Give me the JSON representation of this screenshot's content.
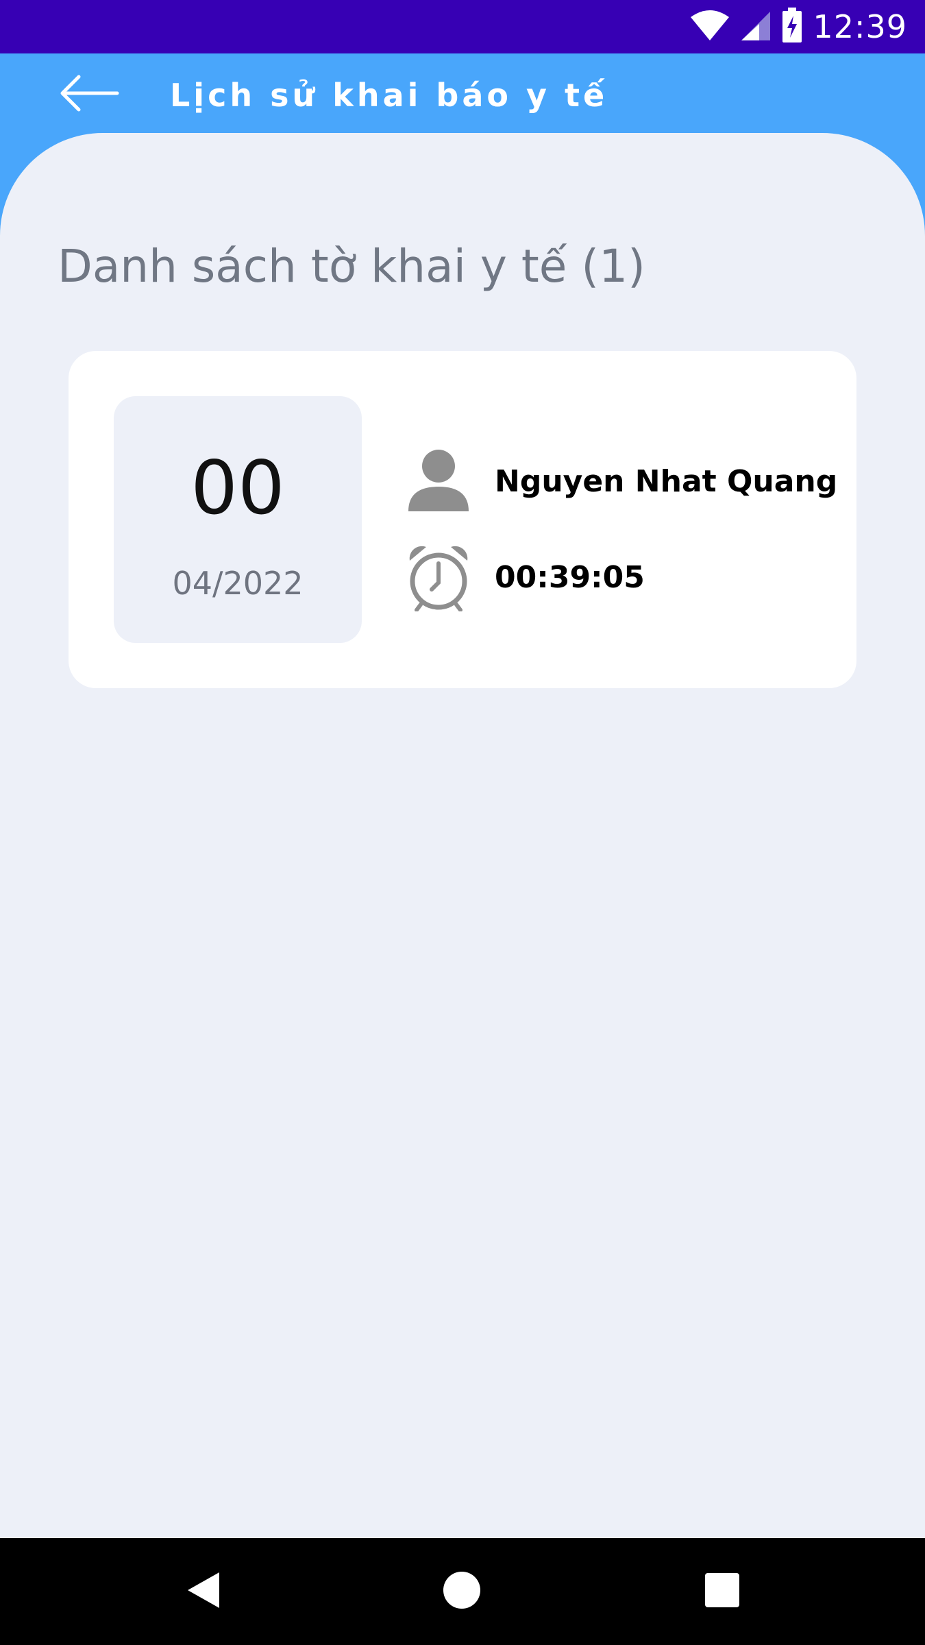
{
  "status_bar": {
    "time": "12:39",
    "icons": [
      "wifi-icon",
      "signal-icon",
      "battery-charging-icon"
    ]
  },
  "app_bar": {
    "title": "Lịch sử khai báo y tế",
    "back_icon": "arrow-left-icon"
  },
  "main": {
    "section_title": "Danh sách tờ khai y tế (1)",
    "records": [
      {
        "day": "00",
        "month_year": "04/2022",
        "name": "Nguyen Nhat Quang",
        "time": "00:39:05",
        "person_icon": "person-icon",
        "clock_icon": "alarm-clock-icon"
      }
    ]
  },
  "nav_bar": {
    "icons": [
      "back-triangle-icon",
      "home-circle-icon",
      "recents-square-icon"
    ]
  },
  "colors": {
    "status_bar": "#3700b4",
    "app_bar": "#49a6fb",
    "background": "#edf0f8",
    "card": "#ffffff"
  }
}
